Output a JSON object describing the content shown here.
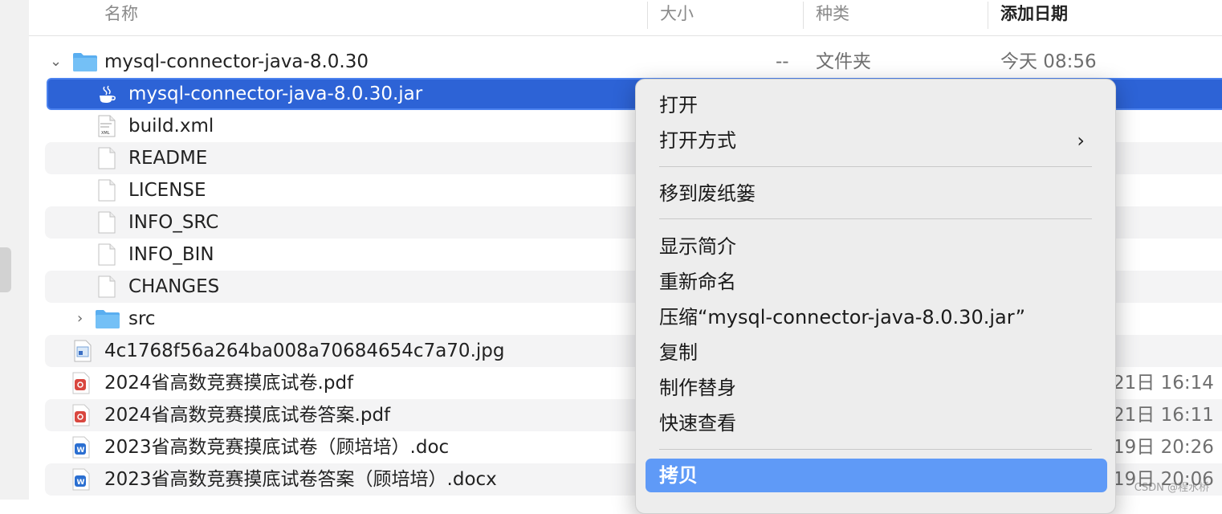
{
  "columns": {
    "name": "名称",
    "size": "大小",
    "kind": "种类",
    "date_added": "添加日期"
  },
  "rows": [
    {
      "name": "mysql-connector-java-8.0.30",
      "size": "--",
      "kind": "文件夹",
      "date": "今天 08:56",
      "icon": "folder-icon",
      "disclosure": "chevron-down-icon"
    },
    {
      "name": "mysql-connector-java-8.0.30.jar",
      "icon": "java-jar-icon"
    },
    {
      "name": "build.xml",
      "icon": "xml-file-icon"
    },
    {
      "name": "README",
      "icon": "file-icon"
    },
    {
      "name": "LICENSE",
      "icon": "file-icon"
    },
    {
      "name": "INFO_SRC",
      "icon": "file-icon"
    },
    {
      "name": "INFO_BIN",
      "icon": "file-icon"
    },
    {
      "name": "CHANGES",
      "icon": "file-icon"
    },
    {
      "name": "src",
      "icon": "folder-icon",
      "disclosure": "chevron-right-icon"
    },
    {
      "name": "4c1768f56a264ba008a70684654c7a70.jpg",
      "icon": "image-file-icon"
    },
    {
      "name": "2024省高数竞赛摸底试卷.pdf",
      "date": "21日 16:14",
      "icon": "pdf-file-icon"
    },
    {
      "name": "2024省高数竞赛摸底试卷答案.pdf",
      "date": "21日 16:11",
      "icon": "pdf-file-icon"
    },
    {
      "name": "2023省高数竞赛摸底试卷（顾培培）.doc",
      "date": "19日 20:26",
      "icon": "word-file-icon"
    },
    {
      "name": "2023省高数竞赛摸底试卷答案（顾培培）.docx",
      "date": "19日 20:06",
      "icon": "word-file-icon"
    }
  ],
  "context_menu": {
    "open": "打开",
    "open_with": "打开方式",
    "move_to_trash": "移到废纸篓",
    "get_info": "显示简介",
    "rename": "重新命名",
    "compress": "压缩“mysql-connector-java-8.0.30.jar”",
    "duplicate": "复制",
    "make_alias": "制作替身",
    "quick_look": "快速查看",
    "copy": "拷贝",
    "submenu_arrow": "›"
  },
  "colors": {
    "selection": "#2d63d6",
    "menu_highlight": "#5f9af7",
    "pdf_red": "#d9473f",
    "word_blue": "#2b6fd1",
    "folder_blue": "#5aaef0"
  },
  "watermark": "CSDN @程水桥"
}
